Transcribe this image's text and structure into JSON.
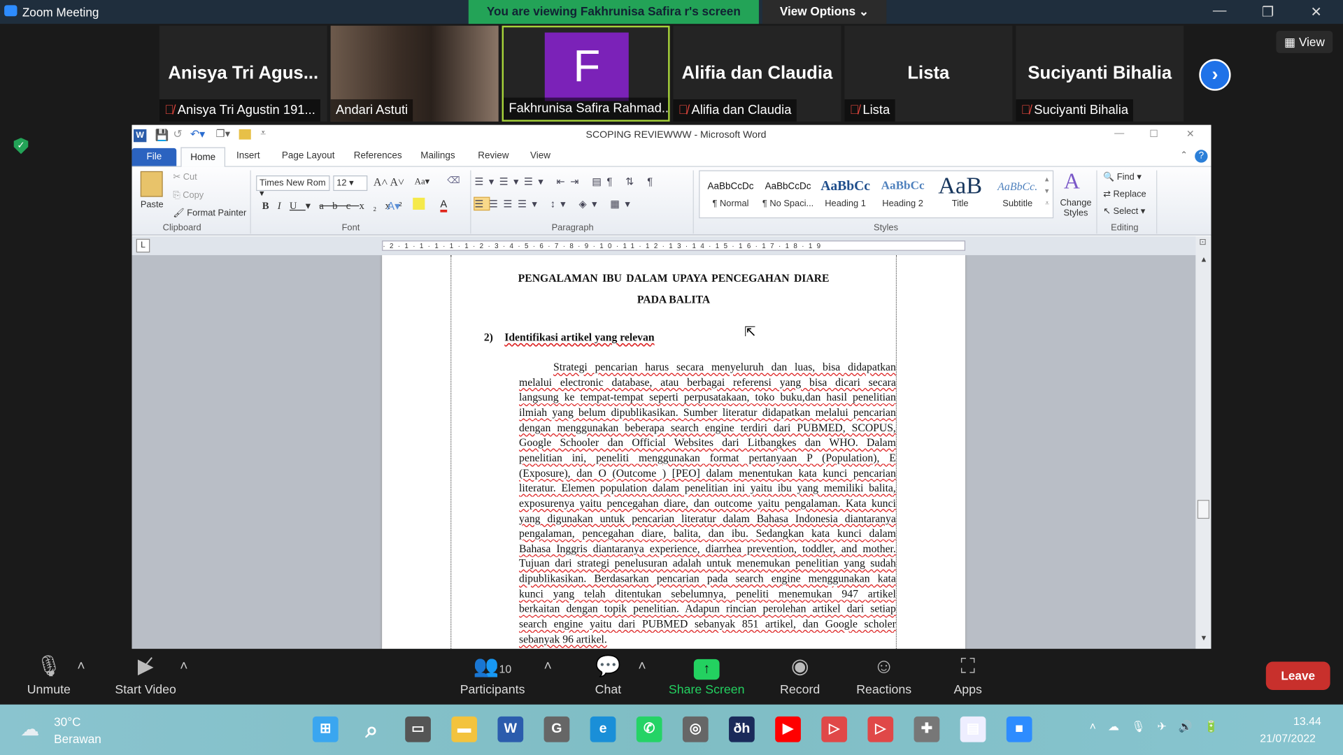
{
  "zoom": {
    "window_title": "Zoom Meeting",
    "banner": "You are viewing Fakhrunisa Safira r's screen",
    "view_options": "View Options ⌄",
    "view_button": "View",
    "participants": [
      {
        "big": "Anisya Tri Agus...",
        "name": "Anisya Tri Agustin 191...",
        "muted": true
      },
      {
        "big": "",
        "name": "Andari Astuti",
        "muted": false,
        "video": true
      },
      {
        "big": "F",
        "name": "Fakhrunisa Safira Rahmad...",
        "muted": false,
        "active": true,
        "avatar_color": "#7b22b8"
      },
      {
        "big": "Alifia dan Claudia",
        "name": "Alifia dan Claudia",
        "muted": true
      },
      {
        "big": "Lista",
        "name": "Lista",
        "muted": true
      },
      {
        "big": "Suciyanti Bihalia",
        "name": "Suciyanti Bihalia",
        "muted": true
      }
    ],
    "toolbar": {
      "unmute": "Unmute",
      "start_video": "Start Video",
      "participants": "Participants",
      "participant_count": "10",
      "chat": "Chat",
      "share_screen": "Share Screen",
      "record": "Record",
      "reactions": "Reactions",
      "apps": "Apps",
      "leave": "Leave"
    },
    "accent": "#23d160",
    "leave_color": "#c8302c"
  },
  "word": {
    "title": "SCOPING REVIEWWW  -  Microsoft Word",
    "tabs": [
      "File",
      "Home",
      "Insert",
      "Page Layout",
      "References",
      "Mailings",
      "Review",
      "View"
    ],
    "clipboard": {
      "paste": "Paste",
      "cut": "Cut",
      "copy": "Copy",
      "format_painter": "Format Painter",
      "group": "Clipboard"
    },
    "font": {
      "name": "Times New Rom",
      "size": "12",
      "group": "Font"
    },
    "paragraph_group": "Paragraph",
    "styles": [
      {
        "sample": "AaBbCcDc",
        "label": "¶ Normal"
      },
      {
        "sample": "AaBbCcDc",
        "label": "¶ No Spaci..."
      },
      {
        "sample": "AaBbCc",
        "label": "Heading 1"
      },
      {
        "sample": "AaBbCc",
        "label": "Heading 2"
      },
      {
        "sample": "AaB",
        "label": "Title"
      },
      {
        "sample": "AaBbCc.",
        "label": "Subtitle"
      }
    ],
    "styles_group": "Styles",
    "change_styles": "Change Styles",
    "editing": {
      "find": "Find ▾",
      "replace": "Replace",
      "select": "Select ▾",
      "group": "Editing"
    },
    "doc": {
      "title1": "PENGALAMAN  IBU  DALAM  UPAYA  PENCEGAHAN  DIARE",
      "title2": "PADA BALITA",
      "heading_num": "2)",
      "heading": "Identifikasi artikel yang relevan",
      "lines": [
        "Strategi pencarian harus secara menyeluruh dan luas, bisa didapatkan",
        "melalui electronic database, atau berbagai referensi yang bisa dicari secara",
        "langsung ke tempat-tempat seperti perpusatakaan, toko buku,dan hasil penelitian",
        "ilmiah yang belum dipublikasikan. Sumber literatur didapatkan melalui pencarian",
        "dengan menggunakan beberapa search engine terdiri dari PUBMED, SCOPUS,",
        "Google Schooler dan Official Websites dari Litbangkes dan WHO. Dalam",
        "penelitian ini, peneliti menggunakan format pertanyaan P (Population), E",
        "(Exposure), dan O (Outcome ) [PEO] dalam menentukan kata kunci pencarian",
        "literatur. Elemen population dalam penelitian ini yaitu ibu yang memiliki balita,",
        "exposurenya yaitu pencegahan diare, dan outcome yaitu pengalaman. Kata kunci",
        "yang digunakan untuk pencarian literatur dalam Bahasa Indonesia diantaranya",
        "pengalaman, pencegahan diare, balita, dan ibu. Sedangkan kata kunci dalam",
        "Bahasa Inggris diantaranya experience, diarrhea prevention, toddler, and mother.",
        "Tujuan dari strategi penelusuran adalah untuk menemukan penelitian yang sudah",
        "dipublikasikan. Berdasarkan pencarian pada search engine menggunakan kata",
        "kunci yang telah ditentukan sebelumnya, peneliti menemukan 947 artikel",
        "berkaitan dengan topik penelitian. Adapun rincian perolehan artikel dari setiap",
        "search engine yaitu dari PUBMED sebanyak 851 artikel, dan Google scholer",
        "sebanyak 96 artikel."
      ]
    }
  },
  "taskbar": {
    "temp": "30°C",
    "weather": "Berawan",
    "time": "13.44",
    "date": "21/07/2022"
  }
}
